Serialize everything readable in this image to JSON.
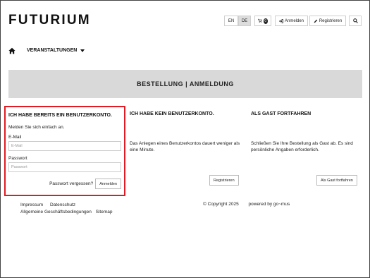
{
  "header": {
    "logo": "FUTURIUM",
    "lang_en": "EN",
    "lang_de": "DE",
    "cart_count": "0",
    "login": "Anmelden",
    "register": "Registrieren"
  },
  "nav": {
    "events": "VERANSTALTUNGEN"
  },
  "banner": {
    "title": "BESTELLUNG | ANMELDUNG"
  },
  "existing": {
    "heading": "ICH HABE BEREITS EIN BENUTZERKONTO.",
    "intro": "Melden Sie sich einfach an.",
    "email_label": "E-Mail",
    "email_placeholder": "E-Mail",
    "password_label": "Passwort",
    "password_placeholder": "Passwort",
    "forgot": "Passwort vergessen?",
    "submit": "Anmelden"
  },
  "new_account": {
    "heading": "ICH HABE KEIN BENUTZERKONTO.",
    "desc": "Das Anlegen eines Benutzerkontos dauert weniger als eine Minute.",
    "button": "Registrieren"
  },
  "guest": {
    "heading": "ALS GAST FORTFAHREN",
    "desc": "Schließen Sie Ihre Bestellung als Gast ab. Es sind persönliche Angaben erforderlich.",
    "button": "Als Gast fortfahren"
  },
  "footer": {
    "impressum": "Impressum",
    "datenschutz": "Datenschutz",
    "agb": "Allgemeine Geschäftsbedingungen",
    "sitemap": "Sitemap",
    "copyright": "© Copyright 2025",
    "powered": "powered by go~mus"
  },
  "colors": {
    "highlight": "#e01b24",
    "banner_bg": "#d9d9d9"
  }
}
